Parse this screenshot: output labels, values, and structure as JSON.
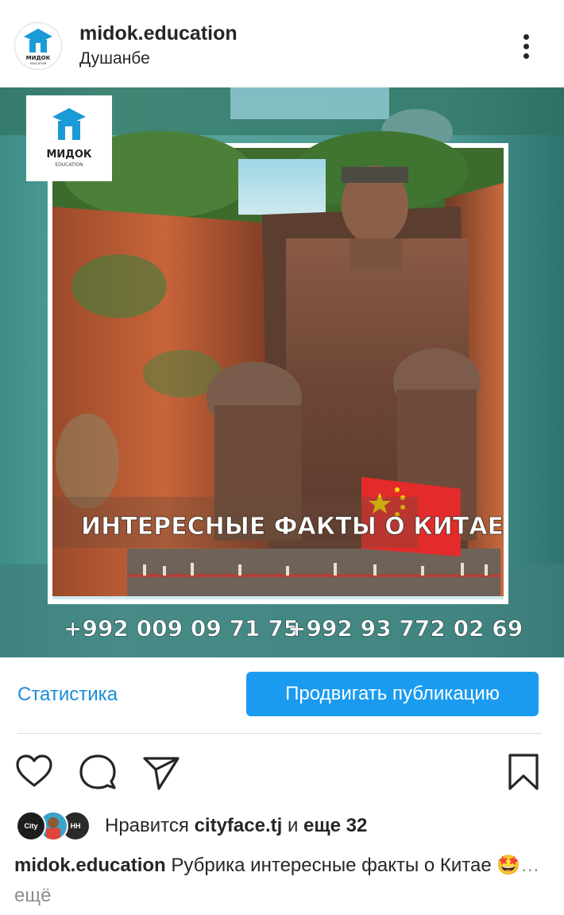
{
  "header": {
    "username": "midok.education",
    "location": "Душанбе",
    "avatar_logo_text": "МИДОК",
    "avatar_logo_sub": "EDUCATION"
  },
  "post": {
    "logo_text": "МИДОК",
    "logo_sub": "EDUCATION",
    "headline": "ИНТЕРЕСНЫЕ ФАКТЫ О КИТАЕ",
    "phone_1": "+992 009 09 71 75",
    "phone_2": "+992 93 772 02 69"
  },
  "actions": {
    "statistics_label": "Статистика",
    "promote_label": "Продвигать публикацию",
    "icons": [
      "heart-icon",
      "comment-icon",
      "share-icon",
      "bookmark-icon"
    ]
  },
  "likes": {
    "prefix": "Нравится",
    "user": "cityface.tj",
    "conjunction": "и",
    "others": "еще 32",
    "liker_labels": [
      "City",
      "",
      "НН"
    ]
  },
  "caption": {
    "username": "midok.education",
    "text": "Рубрика интересные факты о Китае",
    "emoji": "🤩",
    "more_label": "… ещё"
  },
  "colors": {
    "accent": "#1a9bf0",
    "link": "#1a8cd8",
    "text": "#262626",
    "muted": "#8e8e8e",
    "logo_blue": "#1a9bd7"
  }
}
